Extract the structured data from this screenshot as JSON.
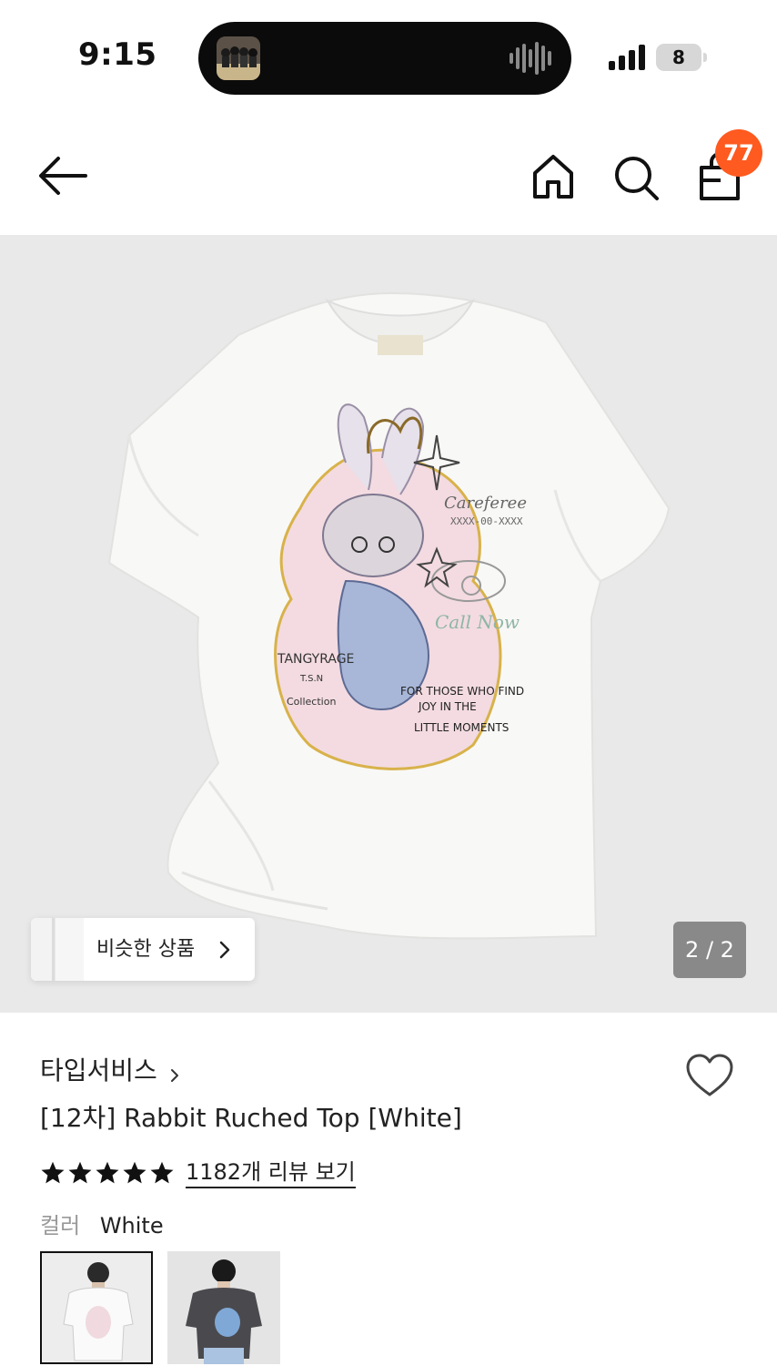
{
  "status_bar": {
    "time": "9:15",
    "battery": "8"
  },
  "nav": {
    "cart_count": "77"
  },
  "gallery": {
    "similar_label": "비슷한 상품",
    "page_indicator": "2 / 2",
    "shirt_print_text": [
      "Careferee",
      "XXXX-00-XXXX",
      "Call Now",
      "TANGYRAGE",
      "T.S.N",
      "Collection",
      "FOR THOSE WHO FIND",
      "JOY IN THE",
      "LITTLE MOMENTS"
    ]
  },
  "product": {
    "brand": "타입서비스",
    "title": "[12차] Rabbit Ruched Top [White]",
    "rating_stars": 5,
    "review_link": "1182개 리뷰 보기",
    "color_label": "컬러",
    "color_value": "White",
    "swatches": [
      "White",
      "Charcoal"
    ]
  },
  "colors": {
    "accent": "#ff5a1f",
    "image_bg": "#e9e9e9",
    "text": "#222222",
    "muted": "#999999"
  }
}
